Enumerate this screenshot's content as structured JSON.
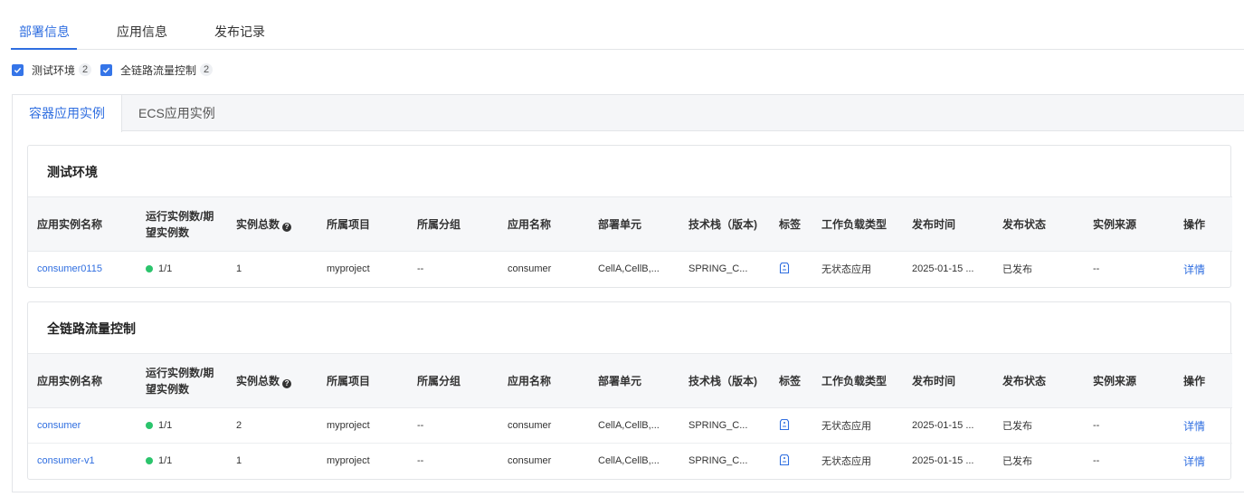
{
  "top_tabs": [
    {
      "label": "部署信息"
    },
    {
      "label": "应用信息"
    },
    {
      "label": "发布记录"
    }
  ],
  "filters": [
    {
      "label": "测试环境",
      "count": "2",
      "checked": true
    },
    {
      "label": "全链路流量控制",
      "count": "2",
      "checked": true
    }
  ],
  "inner_tabs": [
    {
      "label": "容器应用实例"
    },
    {
      "label": "ECS应用实例"
    }
  ],
  "columns": [
    "应用实例名称",
    "运行实例数/期望实例数",
    "实例总数",
    "所属项目",
    "所属分组",
    "应用名称",
    "部署单元",
    "技术栈（版本)",
    "标签",
    "工作负载类型",
    "发布时间",
    "发布状态",
    "实例来源",
    "操作"
  ],
  "panels": [
    {
      "title": "测试环境",
      "rows": [
        {
          "name": "consumer0115",
          "running": "1/1",
          "total": "1",
          "project": "myproject",
          "group": "--",
          "app": "consumer",
          "unit": "CellA,CellB,...",
          "stack": "SPRING_C...",
          "workload": "无状态应用",
          "time": "2025-01-15 ...",
          "status": "已发布",
          "source": "--",
          "op": "详情"
        }
      ]
    },
    {
      "title": "全链路流量控制",
      "rows": [
        {
          "name": "consumer",
          "running": "1/1",
          "total": "2",
          "project": "myproject",
          "group": "--",
          "app": "consumer",
          "unit": "CellA,CellB,...",
          "stack": "SPRING_C...",
          "workload": "无状态应用",
          "time": "2025-01-15 ...",
          "status": "已发布",
          "source": "--",
          "op": "详情"
        },
        {
          "name": "consumer-v1",
          "running": "1/1",
          "total": "1",
          "project": "myproject",
          "group": "--",
          "app": "consumer",
          "unit": "CellA,CellB,...",
          "stack": "SPRING_C...",
          "workload": "无状态应用",
          "time": "2025-01-15 ...",
          "status": "已发布",
          "source": "--",
          "op": "详情"
        }
      ]
    }
  ],
  "colors": {
    "accent": "#2f6ee0",
    "running_dot": "#2bc46c"
  }
}
